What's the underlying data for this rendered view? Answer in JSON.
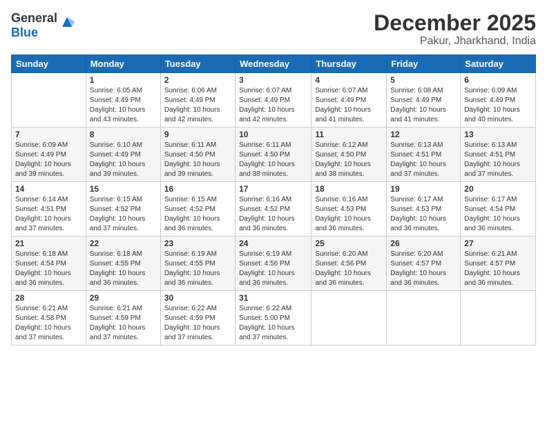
{
  "header": {
    "logo_general": "General",
    "logo_blue": "Blue",
    "month": "December 2025",
    "location": "Pakur, Jharkhand, India"
  },
  "weekdays": [
    "Sunday",
    "Monday",
    "Tuesday",
    "Wednesday",
    "Thursday",
    "Friday",
    "Saturday"
  ],
  "weeks": [
    [
      {
        "day": "",
        "sunrise": "",
        "sunset": "",
        "daylight": ""
      },
      {
        "day": "1",
        "sunrise": "Sunrise: 6:05 AM",
        "sunset": "Sunset: 4:49 PM",
        "daylight": "Daylight: 10 hours and 43 minutes."
      },
      {
        "day": "2",
        "sunrise": "Sunrise: 6:06 AM",
        "sunset": "Sunset: 4:49 PM",
        "daylight": "Daylight: 10 hours and 42 minutes."
      },
      {
        "day": "3",
        "sunrise": "Sunrise: 6:07 AM",
        "sunset": "Sunset: 4:49 PM",
        "daylight": "Daylight: 10 hours and 42 minutes."
      },
      {
        "day": "4",
        "sunrise": "Sunrise: 6:07 AM",
        "sunset": "Sunset: 4:49 PM",
        "daylight": "Daylight: 10 hours and 41 minutes."
      },
      {
        "day": "5",
        "sunrise": "Sunrise: 6:08 AM",
        "sunset": "Sunset: 4:49 PM",
        "daylight": "Daylight: 10 hours and 41 minutes."
      },
      {
        "day": "6",
        "sunrise": "Sunrise: 6:09 AM",
        "sunset": "Sunset: 4:49 PM",
        "daylight": "Daylight: 10 hours and 40 minutes."
      }
    ],
    [
      {
        "day": "7",
        "sunrise": "Sunrise: 6:09 AM",
        "sunset": "Sunset: 4:49 PM",
        "daylight": "Daylight: 10 hours and 39 minutes."
      },
      {
        "day": "8",
        "sunrise": "Sunrise: 6:10 AM",
        "sunset": "Sunset: 4:49 PM",
        "daylight": "Daylight: 10 hours and 39 minutes."
      },
      {
        "day": "9",
        "sunrise": "Sunrise: 6:11 AM",
        "sunset": "Sunset: 4:50 PM",
        "daylight": "Daylight: 10 hours and 39 minutes."
      },
      {
        "day": "10",
        "sunrise": "Sunrise: 6:11 AM",
        "sunset": "Sunset: 4:50 PM",
        "daylight": "Daylight: 10 hours and 38 minutes."
      },
      {
        "day": "11",
        "sunrise": "Sunrise: 6:12 AM",
        "sunset": "Sunset: 4:50 PM",
        "daylight": "Daylight: 10 hours and 38 minutes."
      },
      {
        "day": "12",
        "sunrise": "Sunrise: 6:13 AM",
        "sunset": "Sunset: 4:51 PM",
        "daylight": "Daylight: 10 hours and 37 minutes."
      },
      {
        "day": "13",
        "sunrise": "Sunrise: 6:13 AM",
        "sunset": "Sunset: 4:51 PM",
        "daylight": "Daylight: 10 hours and 37 minutes."
      }
    ],
    [
      {
        "day": "14",
        "sunrise": "Sunrise: 6:14 AM",
        "sunset": "Sunset: 4:51 PM",
        "daylight": "Daylight: 10 hours and 37 minutes."
      },
      {
        "day": "15",
        "sunrise": "Sunrise: 6:15 AM",
        "sunset": "Sunset: 4:52 PM",
        "daylight": "Daylight: 10 hours and 37 minutes."
      },
      {
        "day": "16",
        "sunrise": "Sunrise: 6:15 AM",
        "sunset": "Sunset: 4:52 PM",
        "daylight": "Daylight: 10 hours and 36 minutes."
      },
      {
        "day": "17",
        "sunrise": "Sunrise: 6:16 AM",
        "sunset": "Sunset: 4:52 PM",
        "daylight": "Daylight: 10 hours and 36 minutes."
      },
      {
        "day": "18",
        "sunrise": "Sunrise: 6:16 AM",
        "sunset": "Sunset: 4:53 PM",
        "daylight": "Daylight: 10 hours and 36 minutes."
      },
      {
        "day": "19",
        "sunrise": "Sunrise: 6:17 AM",
        "sunset": "Sunset: 4:53 PM",
        "daylight": "Daylight: 10 hours and 36 minutes."
      },
      {
        "day": "20",
        "sunrise": "Sunrise: 6:17 AM",
        "sunset": "Sunset: 4:54 PM",
        "daylight": "Daylight: 10 hours and 36 minutes."
      }
    ],
    [
      {
        "day": "21",
        "sunrise": "Sunrise: 6:18 AM",
        "sunset": "Sunset: 4:54 PM",
        "daylight": "Daylight: 10 hours and 36 minutes."
      },
      {
        "day": "22",
        "sunrise": "Sunrise: 6:18 AM",
        "sunset": "Sunset: 4:55 PM",
        "daylight": "Daylight: 10 hours and 36 minutes."
      },
      {
        "day": "23",
        "sunrise": "Sunrise: 6:19 AM",
        "sunset": "Sunset: 4:55 PM",
        "daylight": "Daylight: 10 hours and 36 minutes."
      },
      {
        "day": "24",
        "sunrise": "Sunrise: 6:19 AM",
        "sunset": "Sunset: 4:56 PM",
        "daylight": "Daylight: 10 hours and 36 minutes."
      },
      {
        "day": "25",
        "sunrise": "Sunrise: 6:20 AM",
        "sunset": "Sunset: 4:56 PM",
        "daylight": "Daylight: 10 hours and 36 minutes."
      },
      {
        "day": "26",
        "sunrise": "Sunrise: 6:20 AM",
        "sunset": "Sunset: 4:57 PM",
        "daylight": "Daylight: 10 hours and 36 minutes."
      },
      {
        "day": "27",
        "sunrise": "Sunrise: 6:21 AM",
        "sunset": "Sunset: 4:57 PM",
        "daylight": "Daylight: 10 hours and 36 minutes."
      }
    ],
    [
      {
        "day": "28",
        "sunrise": "Sunrise: 6:21 AM",
        "sunset": "Sunset: 4:58 PM",
        "daylight": "Daylight: 10 hours and 37 minutes."
      },
      {
        "day": "29",
        "sunrise": "Sunrise: 6:21 AM",
        "sunset": "Sunset: 4:59 PM",
        "daylight": "Daylight: 10 hours and 37 minutes."
      },
      {
        "day": "30",
        "sunrise": "Sunrise: 6:22 AM",
        "sunset": "Sunset: 4:59 PM",
        "daylight": "Daylight: 10 hours and 37 minutes."
      },
      {
        "day": "31",
        "sunrise": "Sunrise: 6:22 AM",
        "sunset": "Sunset: 5:00 PM",
        "daylight": "Daylight: 10 hours and 37 minutes."
      },
      {
        "day": "",
        "sunrise": "",
        "sunset": "",
        "daylight": ""
      },
      {
        "day": "",
        "sunrise": "",
        "sunset": "",
        "daylight": ""
      },
      {
        "day": "",
        "sunrise": "",
        "sunset": "",
        "daylight": ""
      }
    ]
  ]
}
